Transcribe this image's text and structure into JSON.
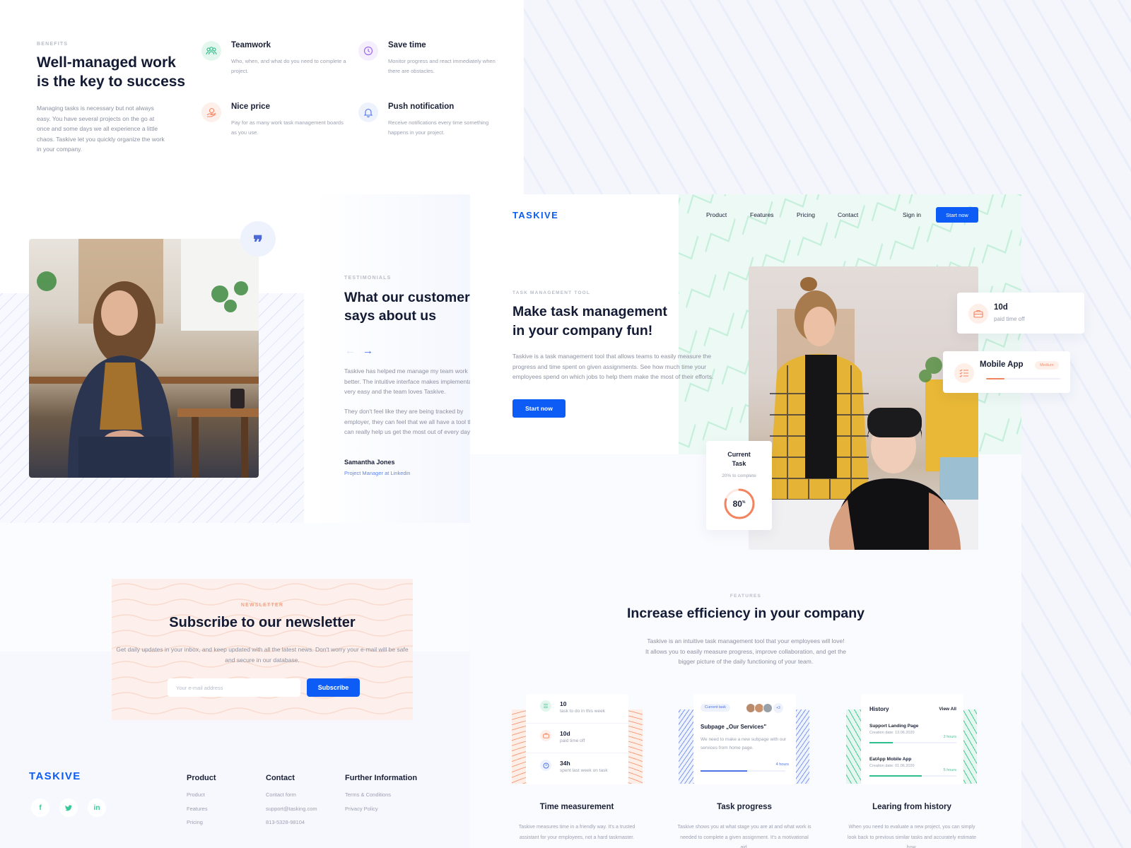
{
  "benefits": {
    "eyebrow": "BENEFITS",
    "title": "Well-managed work is the key to success",
    "description": "Managing tasks is necessary but not always easy. You have several projects on the go at once and some days we all experience a little chaos. Taskive let you quickly organize the work in your company.",
    "features": [
      {
        "icon": "teamwork-icon",
        "title": "Teamwork",
        "description": "Who, when, and what do you need to complete a project.",
        "color": "#e4f7ef",
        "icon_color": "#3cbf93"
      },
      {
        "icon": "clock-icon",
        "title": "Save time",
        "description": "Monitor progress and react immediately when there are obstacles.",
        "color": "#f4eefd",
        "icon_color": "#9b6ce8"
      },
      {
        "icon": "price-hand-icon",
        "title": "Nice price",
        "description": "Pay for as many work task management boards as you use.",
        "color": "#fdefea",
        "icon_color": "#f4845f"
      },
      {
        "icon": "bell-icon",
        "title": "Push notification",
        "description": "Receive notifications every time something happens in your project.",
        "color": "#eef2fd",
        "icon_color": "#4e73e6"
      }
    ]
  },
  "testimonials": {
    "eyebrow": "TESTIMONIALS",
    "title_line1": "What our customer",
    "title_line2": "says about us",
    "quote_icon": "quote-icon",
    "prev_arrow": "←",
    "next_arrow": "→",
    "paragraph1_lines": [
      "Taskive has helped me manage my team work",
      "better. The intuitive interface makes implementation",
      "very easy and the team loves Taskive."
    ],
    "paragraph2_lines": [
      "They don't feel like they are being tracked by",
      "employer, they can feel that we all have a tool that",
      "can really help us get the most out of every day."
    ],
    "author": "Samantha Jones",
    "role": "Project Manager at Linkedin"
  },
  "newsletter": {
    "eyebrow": "NEWSLETTER",
    "title": "Subscribe to our newsletter",
    "description": "Get daily updates in your inbox, and keep updated with all the latest news. Don't worry your e-mail will be safe and secure in our database.",
    "email_placeholder": "Your e-mail address",
    "email_value": "",
    "subscribe_label": "Subscribe"
  },
  "footer": {
    "logo": "TASKIVE",
    "social": [
      {
        "icon": "facebook-icon",
        "glyph": "f"
      },
      {
        "icon": "twitter-icon",
        "glyph": "🐦"
      },
      {
        "icon": "linkedin-icon",
        "glyph": "in"
      }
    ],
    "columns": [
      {
        "title": "Product",
        "links": [
          "Product",
          "Features",
          "Pricing"
        ]
      },
      {
        "title": "Contact",
        "links": [
          "Contact form",
          "support@tasking.com",
          "813-5328-98104"
        ]
      },
      {
        "title": "Further Information",
        "links": [
          "Terms & Conditions",
          "Privacy Policy"
        ]
      }
    ]
  },
  "hero": {
    "logo": "TASKIVE",
    "nav": [
      "Product",
      "Features",
      "Pricing",
      "Contact"
    ],
    "sign_in": "Sign in",
    "nav_cta": "Start now",
    "eyebrow": "TASK MANAGEMENT TOOL",
    "title_line1": "Make task management",
    "title_line2": "in your company fun!",
    "description": "Taskive is a task management tool that allows teams to easily measure the progress and time spent on given assignments. See how much time your employees spend on which jobs to help them make the most of their efforts.",
    "cta": "Start now",
    "pto_card": {
      "value": "10d",
      "label": "paid time off",
      "icon": "briefcase-icon"
    },
    "app_card": {
      "title": "Mobile App",
      "badge": "Medium",
      "progress": 0.25,
      "icon": "checklist-icon"
    },
    "task_card": {
      "title_line1": "Current",
      "title_line2": "Task",
      "subtitle": "20% to complete",
      "percent": 80,
      "percent_sign": "%"
    }
  },
  "features": {
    "eyebrow": "FEATURES",
    "title": "Increase efficiency in your company",
    "description_lines": [
      "Taskive is an intuitive task management tool that your employees will love!",
      "It allows you to easily measure progress, improve collaboration, and get the",
      "bigger picture of the daily functioning of your team."
    ],
    "stats_card": [
      {
        "value": "10",
        "label": "task to do in this week",
        "icon": "list-icon",
        "bg": "#e2f6ee",
        "fg": "#3cbf93"
      },
      {
        "value": "10d",
        "label": "paid time off",
        "icon": "briefcase-icon",
        "bg": "#fdefea",
        "fg": "#f4845f"
      },
      {
        "value": "34h",
        "label": "spent last week on task",
        "icon": "clock-icon",
        "bg": "#eef2fd",
        "fg": "#4e73e6"
      }
    ],
    "task_card": {
      "tag": "Current task",
      "more": "+3",
      "title": "Subpage „Our Services\"",
      "description": "We need to make a new subpage with our services from home page.",
      "hours": "4 hours",
      "progress": 0.55
    },
    "history_card": {
      "title": "History",
      "view_all": "View All",
      "items": [
        {
          "name": "Support Landing Page",
          "date": "Creation date: 13.06.2020",
          "hours": "2 hours",
          "progress": 0.27
        },
        {
          "name": "EatApp Mobile App",
          "date": "Creation date: 01.06.2020",
          "hours": "5 hours",
          "progress": 0.6
        }
      ]
    },
    "columns": [
      {
        "title": "Time measurement",
        "description": "Taskive measures time in a friendly way. It's a trusted assistant for your employees, not a hard taskmaster."
      },
      {
        "title": "Task progress",
        "description": "Taskive shows you at what stage you are at and what work is needed to complete a given assignment. It's a motivational aid."
      },
      {
        "title": "Learing from history",
        "description": "When you need to evaluate a new project, you can simply look back to previous similar tasks and accurately estimate how."
      }
    ]
  }
}
